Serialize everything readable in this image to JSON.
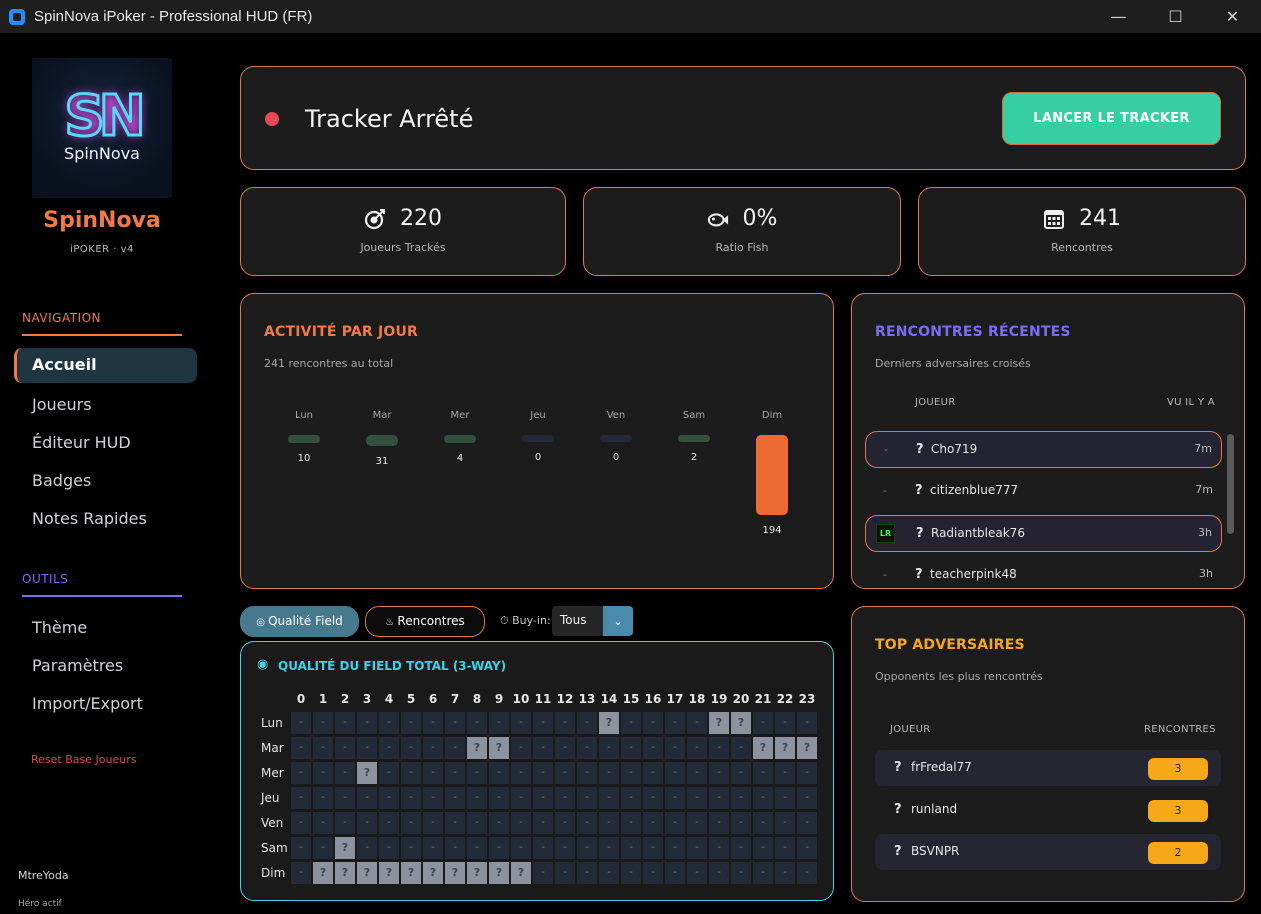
{
  "window": {
    "title": "SpinNova iPoker - Professional HUD (FR)",
    "min": "—",
    "max": "☐",
    "close": "✕"
  },
  "sidebar": {
    "logo_letters": "SN",
    "logo_word": "SpinNova",
    "brand": "SpinNova",
    "brand_sub": "iPOKER · v4",
    "nav_head": "NAVIGATION",
    "nav": [
      "Accueil",
      "Joueurs",
      "Éditeur HUD",
      "Badges",
      "Notes Rapides"
    ],
    "tools_head": "OUTILS",
    "tools": [
      "Thème",
      "Paramètres",
      "Import/Export"
    ],
    "reset": "Reset Base Joueurs",
    "hero_name": "MtreYoda",
    "hero_sub": "Héro actif",
    "accent": "#f07a45",
    "tools_accent": "#7b6cf6"
  },
  "tracker": {
    "status": "Tracker Arrêté",
    "launch": "LANCER LE TRACKER",
    "status_color": "#e84855"
  },
  "stats": [
    {
      "icon": "target-icon",
      "value": "220",
      "label": "Joueurs Trackés"
    },
    {
      "icon": "fish-icon",
      "value": "0%",
      "label": "Ratio Fish"
    },
    {
      "icon": "calendar-icon",
      "value": "241",
      "label": "Rencontres"
    }
  ],
  "activity": {
    "title": "ACTIVITÉ PAR JOUR",
    "subtitle": "241 rencontres au total",
    "days": [
      {
        "label": "Lun",
        "value": 10
      },
      {
        "label": "Mar",
        "value": 31
      },
      {
        "label": "Mer",
        "value": 4
      },
      {
        "label": "Jeu",
        "value": 0
      },
      {
        "label": "Ven",
        "value": 0
      },
      {
        "label": "Sam",
        "value": 2
      },
      {
        "label": "Dim",
        "value": 194
      }
    ]
  },
  "recent": {
    "title": "RENCONTRES RÉCENTES",
    "subtitle": "Derniers adversaires croisés",
    "col_player": "JOUEUR",
    "col_seen": "VU IL Y A",
    "rows": [
      {
        "badge": "",
        "dash": "-",
        "q": "?",
        "name": "Cho719",
        "time": "7m",
        "highlight": true
      },
      {
        "badge": "",
        "dash": "-",
        "q": "?",
        "name": "citizenblue777",
        "time": "7m",
        "highlight": false
      },
      {
        "badge": "LR",
        "dash": "",
        "q": "?",
        "name": "Radiantbleak76",
        "time": "3h",
        "highlight": true
      },
      {
        "badge": "",
        "dash": "-",
        "q": "?",
        "name": "teacherpink48",
        "time": "3h",
        "highlight": false
      }
    ]
  },
  "top": {
    "title": "TOP ADVERSAIRES",
    "subtitle": "Opponents les plus rencontrés",
    "col_player": "JOUEUR",
    "col_count": "RENCONTRES",
    "rows": [
      {
        "q": "?",
        "name": "frFredal77",
        "count": "3"
      },
      {
        "q": "?",
        "name": "runland",
        "count": "3"
      },
      {
        "q": "?",
        "name": "BSVNPR",
        "count": "2"
      }
    ]
  },
  "filters": {
    "tab_field": "Qualité Field",
    "tab_rencontres": "Rencontres",
    "buyin_label": "Buy-in:",
    "buyin_value": "Tous"
  },
  "heatmap": {
    "title": "QUALITÉ DU FIELD TOTAL (3-WAY)",
    "hours": [
      "0",
      "1",
      "2",
      "3",
      "4",
      "5",
      "6",
      "7",
      "8",
      "9",
      "10",
      "11",
      "12",
      "13",
      "14",
      "15",
      "16",
      "17",
      "18",
      "19",
      "20",
      "21",
      "22",
      "23"
    ],
    "days": [
      "Lun",
      "Mar",
      "Mer",
      "Jeu",
      "Ven",
      "Sam",
      "Dim"
    ],
    "empty": "-",
    "active": "?",
    "active_cells": [
      [
        0,
        14
      ],
      [
        0,
        19
      ],
      [
        0,
        20
      ],
      [
        1,
        8
      ],
      [
        1,
        9
      ],
      [
        1,
        21
      ],
      [
        1,
        22
      ],
      [
        1,
        23
      ],
      [
        2,
        3
      ],
      [
        5,
        2
      ],
      [
        6,
        1
      ],
      [
        6,
        2
      ],
      [
        6,
        3
      ],
      [
        6,
        4
      ],
      [
        6,
        5
      ],
      [
        6,
        6
      ],
      [
        6,
        7
      ],
      [
        6,
        8
      ],
      [
        6,
        9
      ],
      [
        6,
        10
      ]
    ]
  }
}
